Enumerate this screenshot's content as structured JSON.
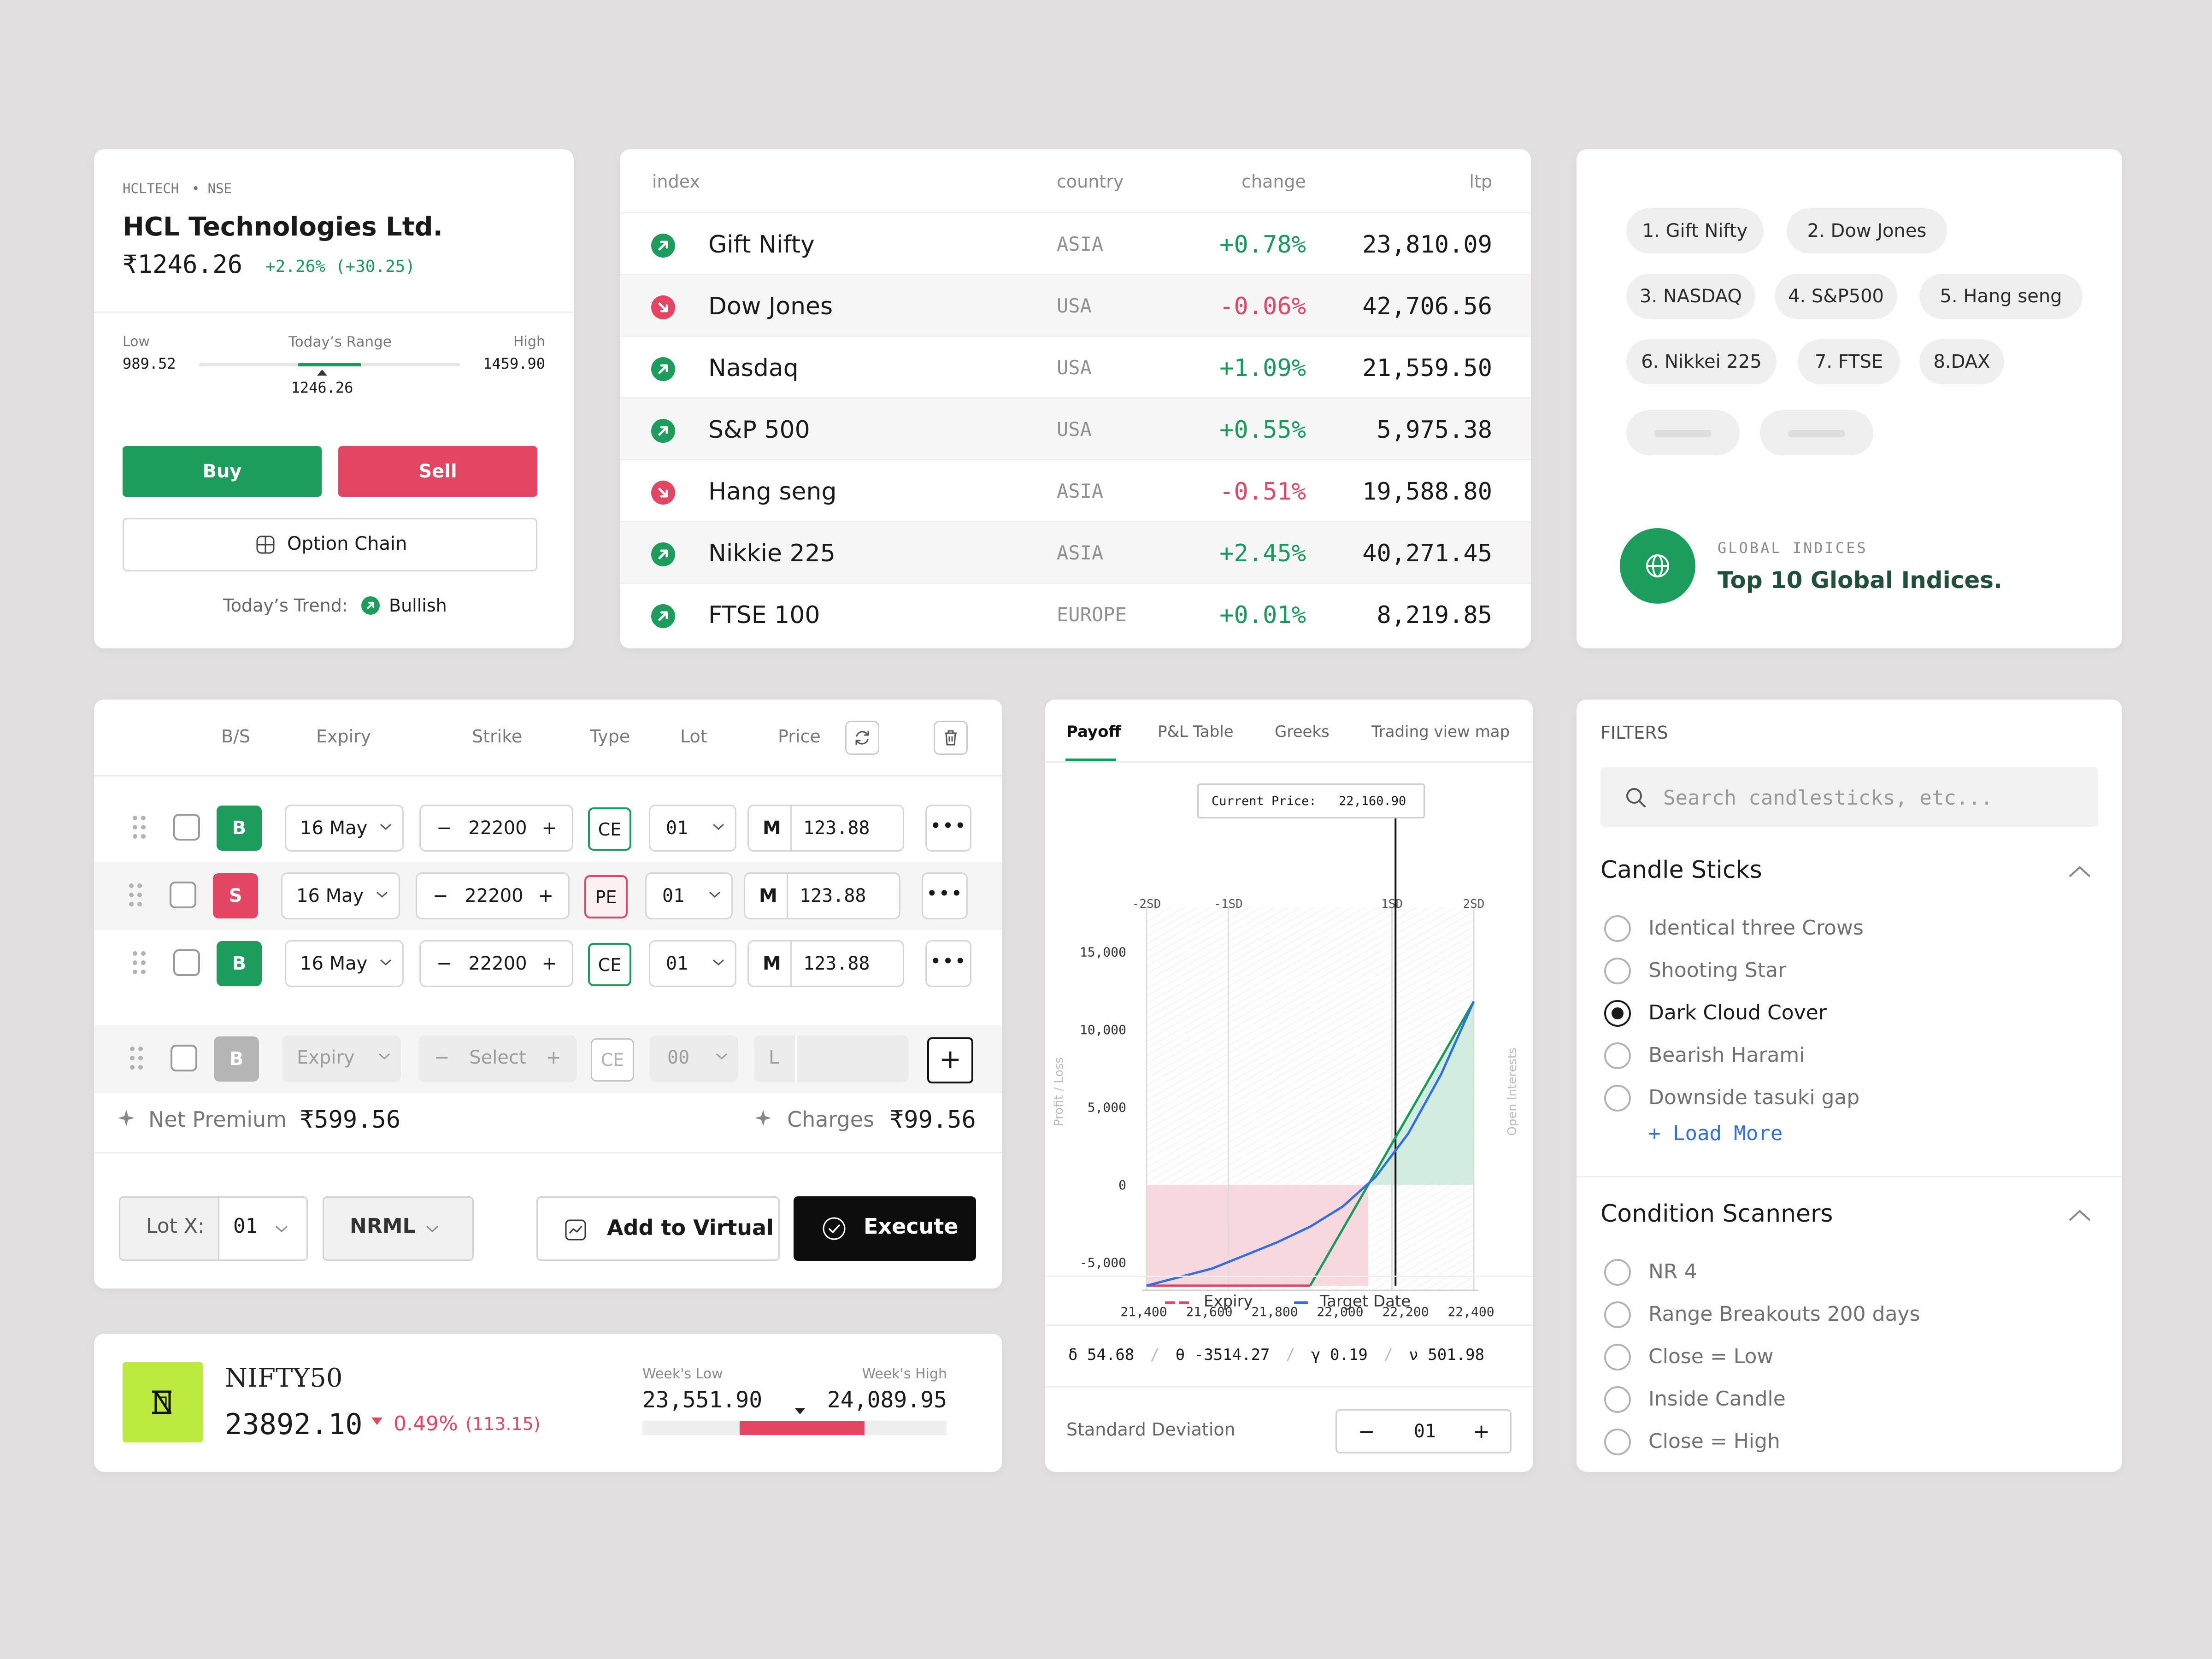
{
  "stock": {
    "ticker": "HCLTECH",
    "exchange": "• NSE",
    "name": "HCL Technologies Ltd.",
    "price": "₹1246.26",
    "change": "+2.26% (+30.25)",
    "low_label": "Low",
    "low_value": "989.52",
    "range_label": "Today’s Range",
    "range_value": "1246.26",
    "range_position": 0.519,
    "high_label": "High",
    "high_value": "1459.90",
    "buy_label": "Buy",
    "sell_label": "Sell",
    "option_chain_label": "Option Chain",
    "trend_label": "Today’s Trend:",
    "trend_value": "Bullish"
  },
  "indices": {
    "headers": {
      "index": "index",
      "country": "country",
      "change": "change",
      "ltp": "ltp"
    },
    "rows": [
      {
        "name": "Gift Nifty",
        "country": "ASIA",
        "change": "+0.78%",
        "ltp": "23,810.09",
        "direction": "up"
      },
      {
        "name": "Dow Jones",
        "country": "USA",
        "change": "-0.06%",
        "ltp": "42,706.56",
        "direction": "down"
      },
      {
        "name": "Nasdaq",
        "country": "USA",
        "change": "+1.09%",
        "ltp": "21,559.50",
        "direction": "up"
      },
      {
        "name": "S&P 500",
        "country": "USA",
        "change": "+0.55%",
        "ltp": "5,975.38",
        "direction": "up"
      },
      {
        "name": "Hang seng",
        "country": "ASIA",
        "change": "-0.51%",
        "ltp": "19,588.80",
        "direction": "down"
      },
      {
        "name": "Nikkie 225",
        "country": "ASIA",
        "change": "+2.45%",
        "ltp": "40,271.45",
        "direction": "up"
      },
      {
        "name": "FTSE 100",
        "country": "EUROPE",
        "change": "+0.01%",
        "ltp": "8,219.85",
        "direction": "up"
      }
    ]
  },
  "global": {
    "chips": [
      "1. Gift Nifty",
      "2. Dow Jones",
      "3. NASDAQ",
      "4. S&P500",
      "5. Hang seng",
      "6. Nikkei 225",
      "7. FTSE",
      "8.DAX"
    ],
    "eyebrow": "GLOBAL INDICES",
    "title": "Top 10 Global Indices."
  },
  "builder": {
    "headers": {
      "bs": "B/S",
      "expiry": "Expiry",
      "strike": "Strike",
      "type": "Type",
      "lot": "Lot",
      "price": "Price"
    },
    "legs": [
      {
        "side": "B",
        "expiry": "16 May",
        "strike": "22200",
        "type": "CE",
        "lot": "01",
        "mode": "M",
        "price": "123.88"
      },
      {
        "side": "S",
        "expiry": "16 May",
        "strike": "22200",
        "type": "PE",
        "lot": "01",
        "mode": "M",
        "price": "123.88"
      },
      {
        "side": "B",
        "expiry": "16 May",
        "strike": "22200",
        "type": "CE",
        "lot": "01",
        "mode": "M",
        "price": "123.88"
      }
    ],
    "new_leg": {
      "side": "B",
      "expiry": "Expiry",
      "strike": "Select",
      "type": "CE",
      "lot": "00",
      "mode": "L"
    },
    "net_premium_label": "Net Premium",
    "net_premium_value": "₹599.56",
    "charges_label": "Charges",
    "charges_value": "₹99.56",
    "lot_label": "Lot X:",
    "lot_value": "01",
    "product": "NRML",
    "add_virtual_label": "Add to Virtual",
    "execute_label": "Execute"
  },
  "nifty": {
    "name": "NIFTY50",
    "price": "23892.10",
    "change": "0.49%",
    "change_points": "(113.15)",
    "week_low_label": "Week's Low",
    "week_low": "23,551.90",
    "week_high_label": "Week's High",
    "week_high": "24,089.95",
    "range_bar_start": 0.32,
    "range_bar_end": 0.73,
    "marker_position": 0.52
  },
  "payoff": {
    "tabs": [
      "Payoff",
      "P&L Table",
      "Greeks",
      "Trading view map"
    ],
    "active_tab": "Payoff",
    "current_price_label": "Current Price:",
    "current_price": "22,160.90",
    "sd_labels": [
      "-2SD",
      "-1SD",
      "1SD",
      "2SD"
    ],
    "legend_expiry": "Expiry",
    "legend_target": "Target Date",
    "greeks": [
      {
        "symbol": "δ",
        "value": "54.68"
      },
      {
        "symbol": "θ",
        "value": "-3514.27"
      },
      {
        "symbol": "γ",
        "value": "0.19"
      },
      {
        "symbol": "ν",
        "value": "501.98"
      }
    ],
    "std_dev_label": "Standard Deviation",
    "std_dev_value": "01"
  },
  "chart_data": {
    "type": "line",
    "title": "",
    "xlabel": "",
    "ylabel": "Profit / Loss",
    "y2label": "Open Interests",
    "x_ticks": [
      "21,400",
      "21,600",
      "21,800",
      "22,000",
      "22,200",
      "22,400"
    ],
    "y_ticks": [
      "15,000",
      "10,000",
      "5,000",
      "0",
      "-5,000"
    ],
    "xlim": [
      21400,
      22400
    ],
    "ylim": [
      -6800,
      17000
    ],
    "current_price": 22160.9,
    "sd_marks": [
      21400,
      21650,
      22150,
      22400
    ],
    "series": [
      {
        "name": "Expiry",
        "color": "#e34563",
        "x": [
          21400,
          21900
        ],
        "y": [
          -6500,
          -6500
        ]
      },
      {
        "name": "Expiry",
        "color": "#179b5a",
        "x": [
          21900,
          22400
        ],
        "y": [
          -6500,
          11800
        ]
      },
      {
        "name": "Target Date",
        "color": "#2f6fe0",
        "x": [
          21400,
          21600,
          21800,
          21900,
          22000,
          22100,
          22200,
          22300,
          22400
        ],
        "y": [
          -6500,
          -5400,
          -3700,
          -2700,
          -1400,
          500,
          3300,
          7100,
          11800
        ]
      }
    ]
  },
  "filters": {
    "title": "FILTERS",
    "search_placeholder": "Search candlesticks, etc...",
    "candle_title": "Candle Sticks",
    "candle_options": [
      "Identical three Crows",
      "Shooting Star",
      "Dark Cloud Cover",
      "Bearish Harami",
      "Downside tasuki gap"
    ],
    "candle_selected": 2,
    "load_more": "+ Load More",
    "scanner_title": "Condition Scanners",
    "scanner_options": [
      "NR 4",
      "Range Breakouts 200 days",
      "Close = Low",
      "Inside Candle",
      "Close = High"
    ]
  },
  "colors": {
    "green": "#179b5a",
    "red": "#e34563",
    "blue": "#2f6fe0",
    "lime": "#bdea3f",
    "execute_bg": "#0d0d0d"
  }
}
